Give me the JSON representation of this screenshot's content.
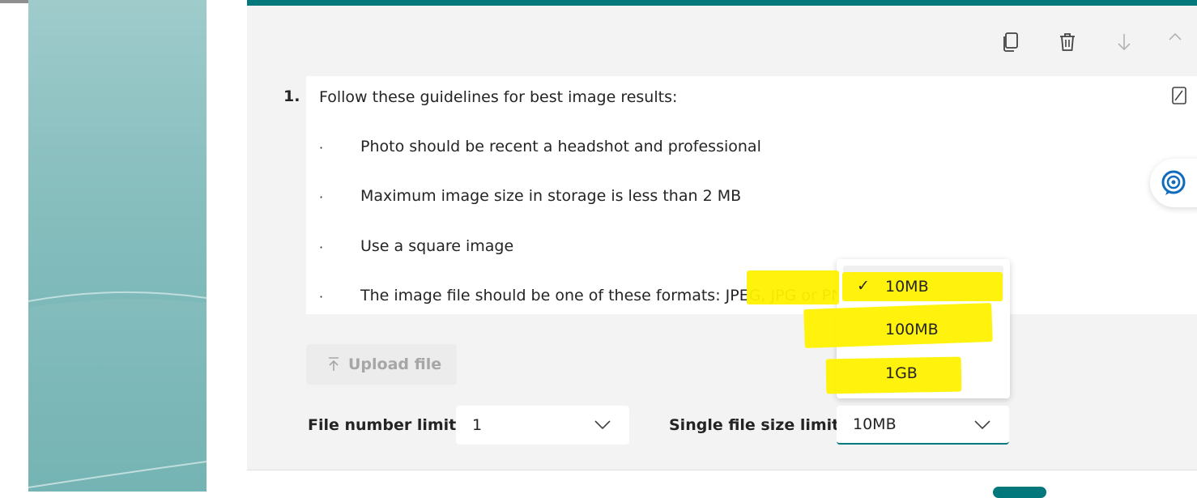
{
  "question": {
    "number": "1.",
    "intro": "Follow these guidelines for best image results:",
    "bullet_char": "·",
    "bullets": [
      "Photo should be recent a headshot and professional",
      "Maximum image size in storage is less than 2 MB",
      "Use a square image",
      "The image file should be one of these formats: JPEG, JPG or PN"
    ]
  },
  "upload": {
    "icon": "upload-arrow-icon",
    "label": "Upload file"
  },
  "file_number": {
    "label": "File number limit:",
    "value": "1"
  },
  "file_size": {
    "label": "Single file size limit:",
    "value": "10MB"
  },
  "dropdown": {
    "options": [
      "10MB",
      "100MB",
      "1GB"
    ],
    "selected": "10MB",
    "check_mark": "✓"
  },
  "toolbar": {
    "icons": [
      "copy-icon",
      "delete-icon",
      "move-down-icon",
      "move-up-icon"
    ]
  },
  "colors": {
    "accent": "#03787c",
    "highlight": "#fff200",
    "card_bg": "#f3f3f3"
  }
}
